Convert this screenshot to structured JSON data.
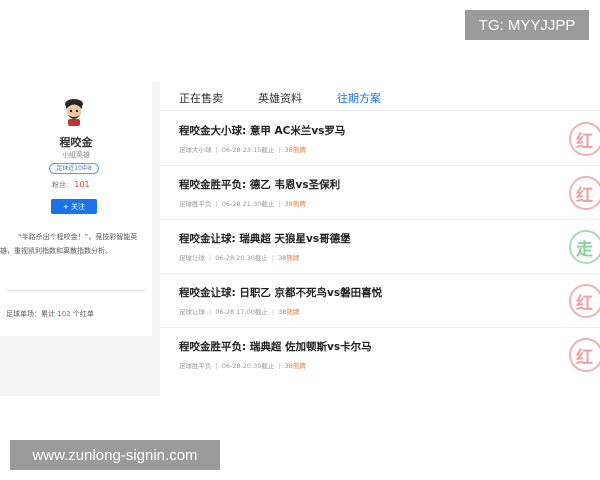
{
  "watermarks": {
    "tg": "TG: MYYJJPP",
    "site": "www.zunlong-signin.com"
  },
  "expert": {
    "name": "程咬金",
    "subtitle": "小组英雄",
    "record_badge": "足球近10中8",
    "fans_label": "粉丝:",
    "fans_count": "101",
    "follow_label": "+ 关注",
    "quote": "“半路杀出个程咬金！”，竞技彩智能英雄，重视凯利指数和离散指数分析。",
    "cumulative_prefix": "足球单场：累计",
    "cumulative_count": "102",
    "cumulative_suffix": "个红单"
  },
  "tabs": [
    {
      "label": "正在售卖",
      "active": false
    },
    {
      "label": "英雄资料",
      "active": false
    },
    {
      "label": "往期方案",
      "active": true
    }
  ],
  "plans": [
    {
      "title": "程咬金大小球: 意甲 AC米兰vs罗马",
      "category": "足球大小球",
      "deadline": "06-28 23:15截止",
      "sale": "38熊牌",
      "stamp": "红",
      "stamp_color": "red"
    },
    {
      "title": "程咬金胜平负: 德乙 韦恩vs圣保利",
      "category": "足球胜平负",
      "deadline": "06-28 21:30截止",
      "sale": "38熊牌",
      "stamp": "红",
      "stamp_color": "red"
    },
    {
      "title": "程咬金让球: 瑞典超 天狼星vs哥德堡",
      "category": "足球让球",
      "deadline": "06-28 20:30截止",
      "sale": "38熊牌",
      "stamp": "走",
      "stamp_color": "green"
    },
    {
      "title": "程咬金让球: 日职乙 京都不死鸟vs磐田喜悦",
      "category": "足球让球",
      "deadline": "06-28 17:00截止",
      "sale": "38熊牌",
      "stamp": "红",
      "stamp_color": "red"
    },
    {
      "title": "程咬金胜平负: 瑞典超 佐加顿斯vs卡尔马",
      "category": "足球胜平负",
      "deadline": "06-28 20:30截止",
      "sale": "38熊牌",
      "stamp": "红",
      "stamp_color": "red"
    }
  ],
  "colors": {
    "accent": "#1a73e8",
    "price": "#e47a3a",
    "highlight": "#e04a3c",
    "stamp_red": "#f0a0a0",
    "stamp_green": "#8ccf9f"
  }
}
